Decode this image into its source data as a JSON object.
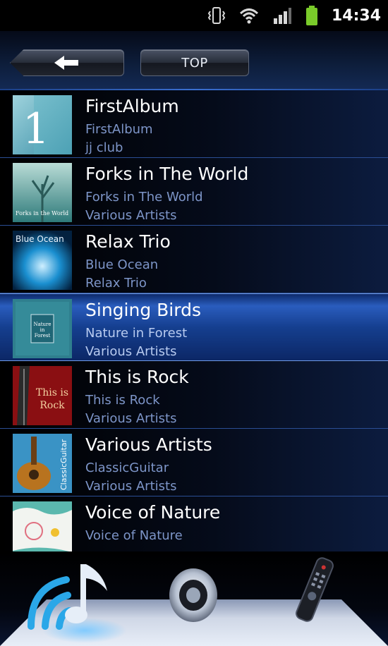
{
  "status_bar": {
    "time": "14:34",
    "icons": [
      "vibrate-icon",
      "wifi-icon",
      "signal-icon",
      "battery-icon"
    ]
  },
  "toolbar": {
    "back_icon": "back-arrow-icon",
    "top_label": "TOP"
  },
  "albums": [
    {
      "title": "FirstAlbum",
      "album": "FirstAlbum",
      "artist": "jj club",
      "thumb_text": "1"
    },
    {
      "title": "Forks in The World",
      "album": "Forks in The World",
      "artist": "Various Artists",
      "thumb_text": "Forks in the World"
    },
    {
      "title": "Relax Trio",
      "album": "Blue Ocean",
      "artist": "Relax Trio",
      "thumb_text": "Blue Ocean"
    },
    {
      "title": "Singing Birds",
      "album": "Nature in Forest",
      "artist": "Various Artists",
      "thumb_text": "Nature in Forest",
      "selected": true
    },
    {
      "title": "This is Rock",
      "album": "This is Rock",
      "artist": "Various Artists",
      "thumb_text": "This is Rock"
    },
    {
      "title": "Various Artists",
      "album": "ClassicGuitar",
      "artist": "Various Artists",
      "thumb_text": "ClassicGuitar"
    },
    {
      "title": "Voice of Nature",
      "album": "Voice of Nature",
      "artist": "",
      "thumb_text": ""
    }
  ],
  "dock": {
    "items": [
      "music-stream-icon",
      "speaker-icon",
      "remote-control-icon"
    ]
  },
  "colors": {
    "accent": "#2a5dbe",
    "secondary_text": "#7d95c8"
  }
}
